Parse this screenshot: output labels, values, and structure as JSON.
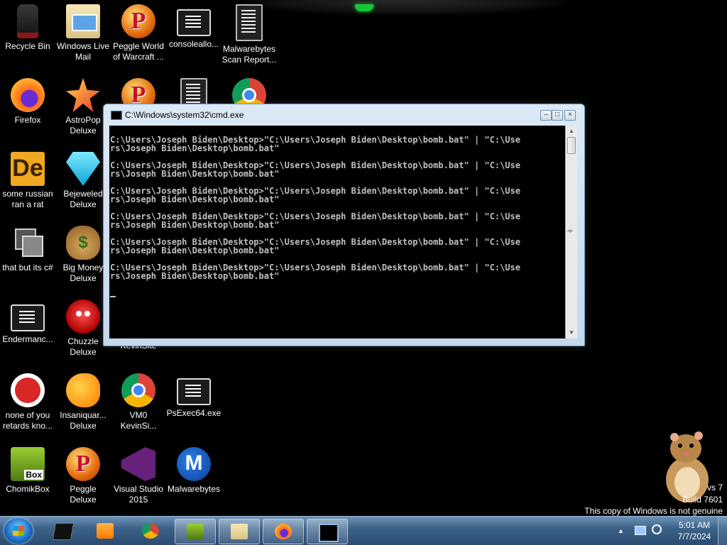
{
  "desktop": {
    "icons": [
      {
        "label": "Recycle Bin"
      },
      {
        "label": "Windows Live Mail"
      },
      {
        "label": "Peggle World of Warcraft ..."
      },
      {
        "label": "consoleallo..."
      },
      {
        "label": "Malwarebytes Scan Report..."
      },
      {
        "label": "Firefox"
      },
      {
        "label": "AstroPop Deluxe"
      },
      {
        "label": "some russian ran a rat"
      },
      {
        "label": "Bejeweled Deluxe"
      },
      {
        "label": "that but its c#"
      },
      {
        "label": "Big Money Deluxe"
      },
      {
        "label": "Endermanc..."
      },
      {
        "label": "Chuzzle Deluxe"
      },
      {
        "label": "KevinSite"
      },
      {
        "label": "none of you retards kno..."
      },
      {
        "label": "Insaniquar... Deluxe"
      },
      {
        "label": "VM0 KevinSi..."
      },
      {
        "label": "PsExec64.exe"
      },
      {
        "label": "ChomikBox"
      },
      {
        "label": "Peggle Deluxe"
      },
      {
        "label": "Visual Studio 2015"
      },
      {
        "label": "Malwarebytes"
      }
    ]
  },
  "cmd": {
    "title": "C:\\Windows\\system32\\cmd.exe",
    "output": "\nC:\\Users\\Joseph Biden\\Desktop>\"C:\\Users\\Joseph Biden\\Desktop\\bomb.bat\" | \"C:\\Use\nrs\\Joseph Biden\\Desktop\\bomb.bat\"\n\nC:\\Users\\Joseph Biden\\Desktop>\"C:\\Users\\Joseph Biden\\Desktop\\bomb.bat\" | \"C:\\Use\nrs\\Joseph Biden\\Desktop\\bomb.bat\"\n\nC:\\Users\\Joseph Biden\\Desktop>\"C:\\Users\\Joseph Biden\\Desktop\\bomb.bat\" | \"C:\\Use\nrs\\Joseph Biden\\Desktop\\bomb.bat\"\n\nC:\\Users\\Joseph Biden\\Desktop>\"C:\\Users\\Joseph Biden\\Desktop\\bomb.bat\" | \"C:\\Use\nrs\\Joseph Biden\\Desktop\\bomb.bat\"\n\nC:\\Users\\Joseph Biden\\Desktop>\"C:\\Users\\Joseph Biden\\Desktop\\bomb.bat\" | \"C:\\Use\nrs\\Joseph Biden\\Desktop\\bomb.bat\"\n\nC:\\Users\\Joseph Biden\\Desktop>\"C:\\Users\\Joseph Biden\\Desktop\\bomb.bat\" | \"C:\\Use\nrs\\Joseph Biden\\Desktop\\bomb.bat\"\n\n"
  },
  "watermark": {
    "line1": "vs 7",
    "line2": "Build 7601",
    "line3": "This copy of Windows is not genuine"
  },
  "taskbar": {
    "clock_time": "5:01 AM",
    "clock_date": "7/7/2024",
    "items": [
      "console",
      "media-player",
      "chrome",
      "chomikbox",
      "windows-live-mail",
      "firefox",
      "cmd"
    ]
  },
  "colors": {
    "desktop_bg": "#000000",
    "taskbar": "#3d6389",
    "cmd_text": "#c0c0c0"
  }
}
